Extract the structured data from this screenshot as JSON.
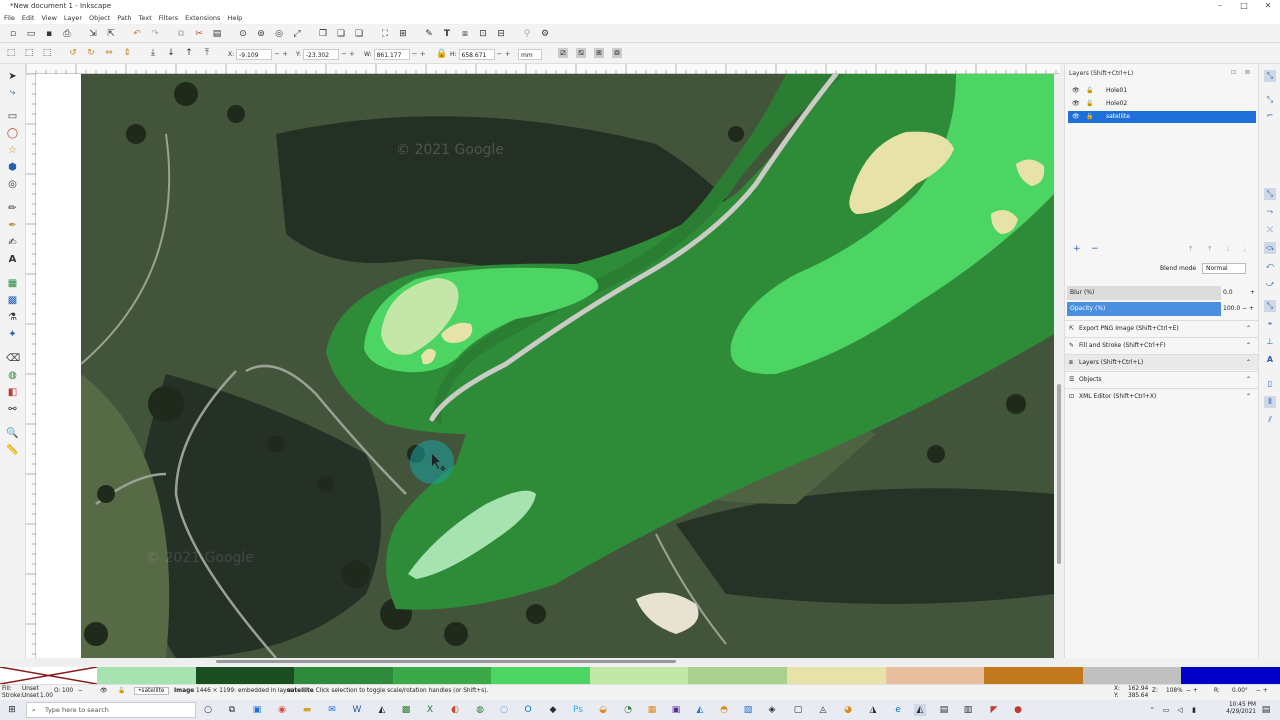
{
  "window": {
    "title": "*New document 1 - Inkscape",
    "min": "–",
    "max": "□",
    "close": "✕"
  },
  "menu": [
    "File",
    "Edit",
    "View",
    "Layer",
    "Object",
    "Path",
    "Text",
    "Filters",
    "Extensions",
    "Help"
  ],
  "controls": {
    "x_label": "X:",
    "x_value": "-9.109",
    "y_label": "Y:",
    "y_value": "-23.302",
    "w_label": "W:",
    "w_value": "861.177",
    "h_label": "H:",
    "h_value": "658.671",
    "unit": "mm"
  },
  "layers_panel": {
    "title": "Layers (Shift+Ctrl+L)",
    "layers": [
      {
        "name": "Hole01",
        "selected": false
      },
      {
        "name": "Hole02",
        "selected": false
      },
      {
        "name": "satellite",
        "selected": true
      }
    ],
    "blend_label": "Blend mode",
    "blend_value": "Normal",
    "blur_label": "Blur (%)",
    "blur_value": "0.0",
    "blur_fraction": 0.0,
    "opacity_label": "Opacity (%)",
    "opacity_value": "100.0",
    "opacity_fraction": 1.0,
    "dialogs": [
      "Export PNG Image (Shift+Ctrl+E)",
      "Fill and Stroke (Shift+Ctrl+F)",
      "Layers (Shift+Ctrl+L)",
      "Objects",
      "XML Editor (Shift+Ctrl+X)"
    ]
  },
  "canvas": {
    "watermark_1": "© 2021 Google",
    "watermark_2": "© 2021 Google"
  },
  "palette": [
    "#a6e3b0",
    "#1a4d1f",
    "#2d8a3a",
    "#3aaa48",
    "#4cd563",
    "#c2e8a8",
    "#a9d08e",
    "#e7e3a8",
    "#e8c0a0",
    "#c2781c",
    "#c0c0c0",
    "#0000c8"
  ],
  "status": {
    "fill_label": "Fill:",
    "fill_value": "Unset",
    "stroke_label": "Stroke:",
    "stroke_value": "Unset",
    "stroke_width": "1.00",
    "opacity_short": "O:",
    "opacity_short_value": "100",
    "layer_select": "•satellite",
    "message_prefix": "Image",
    "message": "1446 × 1199: embedded in layer",
    "message_layer": "satellite",
    "message_suffix": ". Click selection to toggle scale/rotation handles (or Shift+s).",
    "cursor_x_label": "X:",
    "cursor_x": "162.94",
    "cursor_y_label": "Y:",
    "cursor_y": "385.64",
    "zoom_label": "Z:",
    "zoom": "108%",
    "rotate_label": "R:",
    "rotate": "0.00°"
  },
  "taskbar": {
    "search_placeholder": "Type here to search",
    "time": "10:45 PM",
    "date": "4/29/2021"
  }
}
